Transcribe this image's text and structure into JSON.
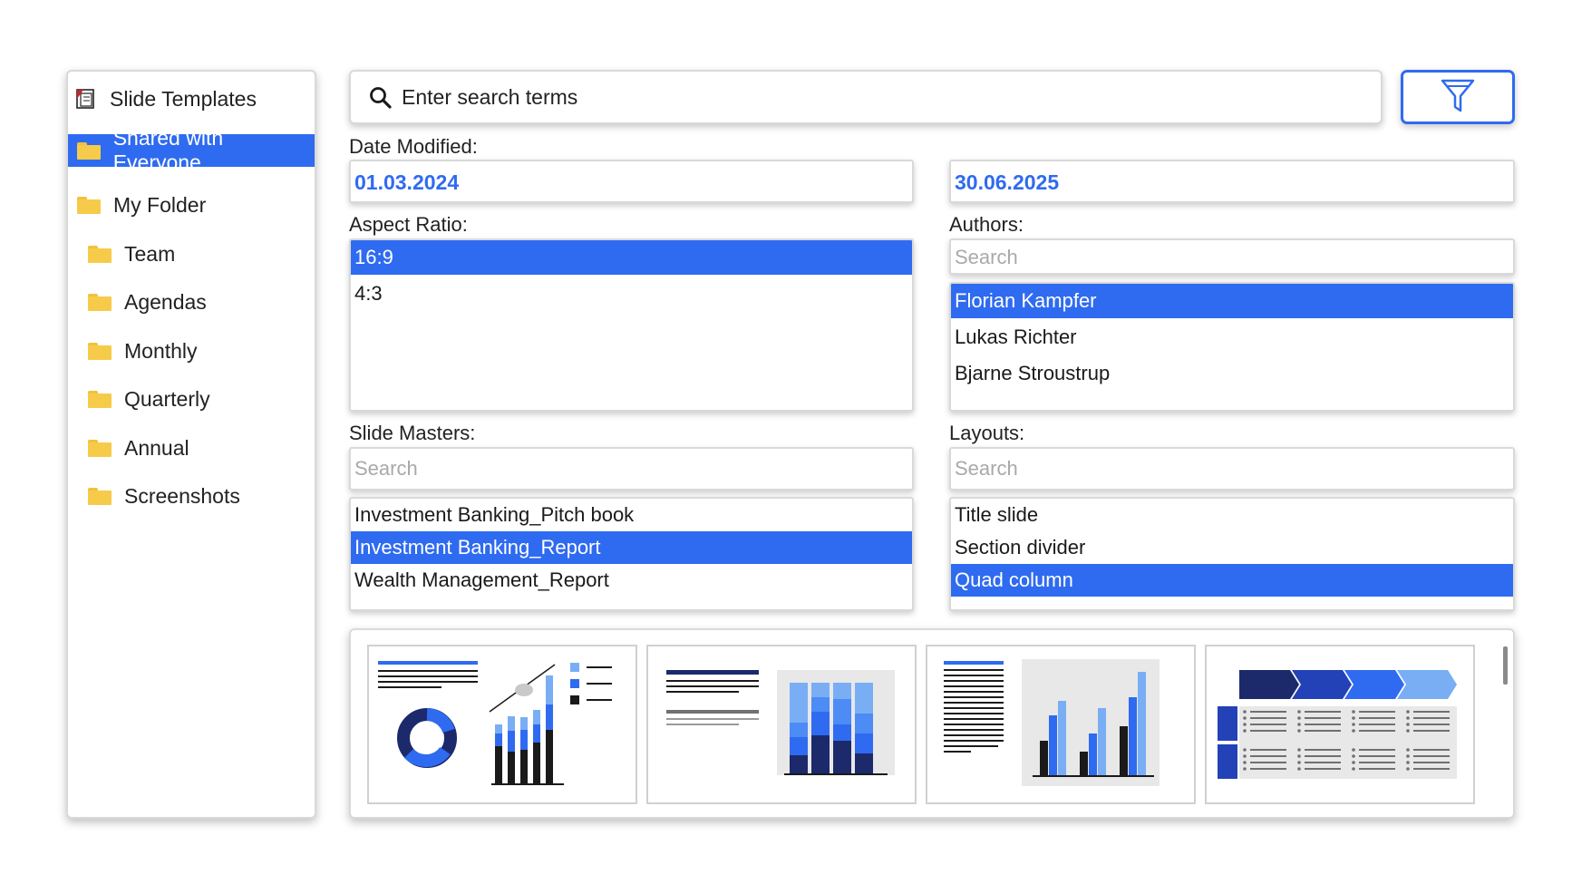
{
  "sidebar": {
    "header": "Slide Templates",
    "items": [
      {
        "label": "Shared with Everyone",
        "selected": true
      },
      {
        "label": "My Folder"
      },
      {
        "label": "Team"
      },
      {
        "label": "Agendas"
      },
      {
        "label": "Monthly"
      },
      {
        "label": "Quarterly"
      },
      {
        "label": "Annual"
      },
      {
        "label": "Screenshots"
      }
    ]
  },
  "search": {
    "placeholder": "Enter search terms",
    "icon": "search-icon"
  },
  "filter": {
    "icon": "filter-icon"
  },
  "date_modified": {
    "label": "Date Modified:",
    "from": "01.03.2024",
    "to": "30.06.2025"
  },
  "aspect_ratio": {
    "label": "Aspect Ratio:",
    "options": [
      "16:9",
      "4:3"
    ],
    "selected": "16:9"
  },
  "authors": {
    "label": "Authors:",
    "search_placeholder": "Search",
    "options": [
      "Florian Kampfer",
      "Lukas Richter",
      "Bjarne Stroustrup"
    ],
    "selected": "Florian Kampfer"
  },
  "slide_masters": {
    "label": "Slide Masters:",
    "search_placeholder": "Search",
    "options": [
      "Investment Banking_Pitch book",
      "Investment Banking_Report",
      "Wealth Management_Report"
    ],
    "selected": "Investment Banking_Report"
  },
  "layouts": {
    "label": "Layouts:",
    "search_placeholder": "Search",
    "options": [
      "Title slide",
      "Section divider",
      "Quad column"
    ],
    "selected": "Quad column"
  },
  "colors": {
    "accent": "#2f6bf0",
    "navy": "#1c2a6b",
    "light_blue": "#79aef5",
    "folder": "#f6cb4a"
  }
}
